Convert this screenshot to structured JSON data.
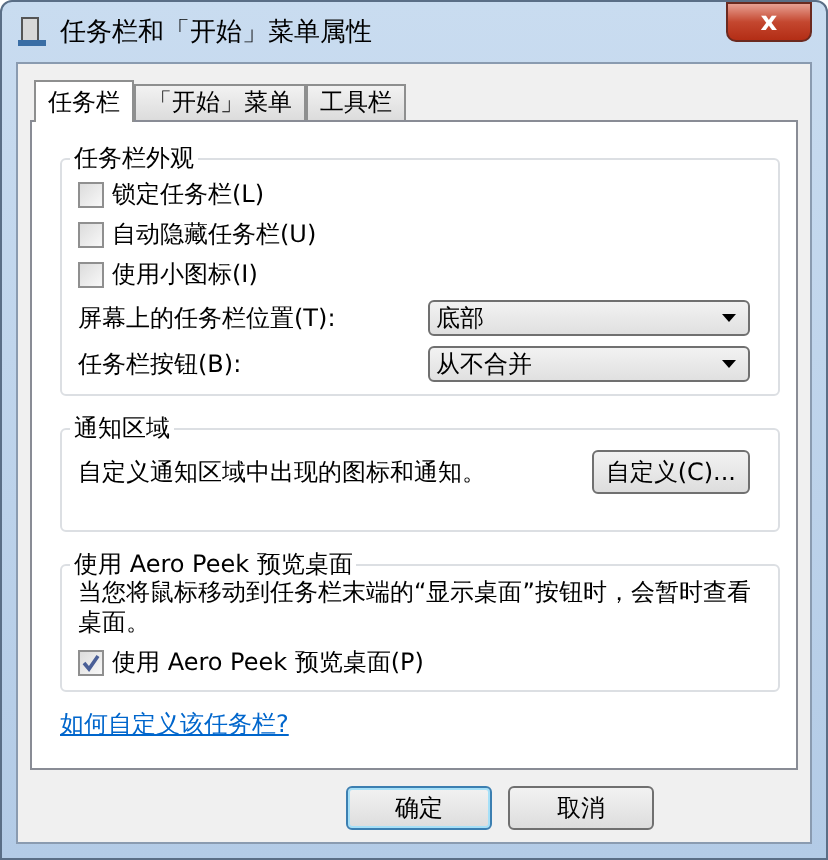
{
  "window": {
    "title": "任务栏和「开始」菜单属性",
    "close": "x"
  },
  "tabs": [
    {
      "label": "任务栏",
      "selected": true
    },
    {
      "label": "「开始」菜单",
      "selected": false
    },
    {
      "label": "工具栏",
      "selected": false
    }
  ],
  "appearance": {
    "title": "任务栏外观",
    "checkboxes": [
      {
        "label": "锁定任务栏(L)",
        "checked": false
      },
      {
        "label": "自动隐藏任务栏(U)",
        "checked": false
      },
      {
        "label": "使用小图标(I)",
        "checked": false
      }
    ],
    "dropdowns": [
      {
        "label": "屏幕上的任务栏位置(T):",
        "value": "底部"
      },
      {
        "label": "任务栏按钮(B):",
        "value": "从不合并"
      }
    ]
  },
  "notification": {
    "title": "通知区域",
    "text": "自定义通知区域中出现的图标和通知。",
    "button": "自定义(C)..."
  },
  "peek": {
    "title": "使用 Aero Peek 预览桌面",
    "text": "当您将鼠标移动到任务栏末端的“显示桌面”按钮时，会暂时查看桌面。",
    "checkbox": {
      "label": "使用 Aero Peek 预览桌面(P)",
      "checked": true
    }
  },
  "help_link": "如何自定义该任务栏?",
  "buttons": [
    "确定",
    "取消"
  ]
}
